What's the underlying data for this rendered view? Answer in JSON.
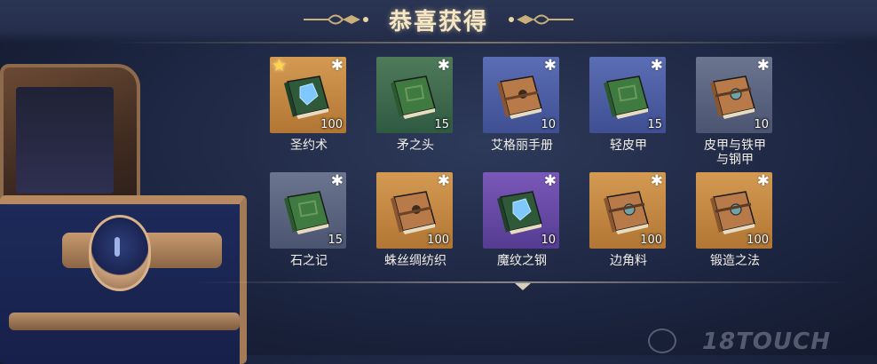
{
  "title": "恭喜获得",
  "watermark": "18TOUCH",
  "colors": {
    "gold": "#c28a44",
    "green": "#3f6a4e",
    "blue": "#4d5ea3",
    "gray": "#5b6480",
    "purple": "#674aa5"
  },
  "rewards": [
    {
      "name": "圣约术",
      "qty": "100",
      "rarity": "gold",
      "icon": "book-blue-dragon-icon",
      "starred": true
    },
    {
      "name": "矛之头",
      "qty": "15",
      "rarity": "green",
      "icon": "book-green-icon",
      "starred": false
    },
    {
      "name": "艾格丽手册",
      "qty": "10",
      "rarity": "blue",
      "icon": "book-leather-icon",
      "starred": false
    },
    {
      "name": "轻皮甲",
      "qty": "15",
      "rarity": "blue",
      "icon": "book-green-icon",
      "starred": false
    },
    {
      "name": "皮甲与铁甲与钢甲",
      "qty": "10",
      "rarity": "gray",
      "icon": "book-leather-clasp-icon",
      "starred": false
    },
    {
      "name": "石之记",
      "qty": "15",
      "rarity": "gray",
      "icon": "book-green-icon",
      "starred": false
    },
    {
      "name": "蛛丝绸纺织",
      "qty": "100",
      "rarity": "gold",
      "icon": "book-leather-icon",
      "starred": false
    },
    {
      "name": "魔纹之钢",
      "qty": "10",
      "rarity": "purple",
      "icon": "book-blue-dragon-icon",
      "starred": false
    },
    {
      "name": "边角料",
      "qty": "100",
      "rarity": "gold",
      "icon": "book-leather-clasp-icon",
      "starred": false
    },
    {
      "name": "锻造之法",
      "qty": "100",
      "rarity": "gold",
      "icon": "book-leather-clasp-icon",
      "starred": false
    }
  ]
}
